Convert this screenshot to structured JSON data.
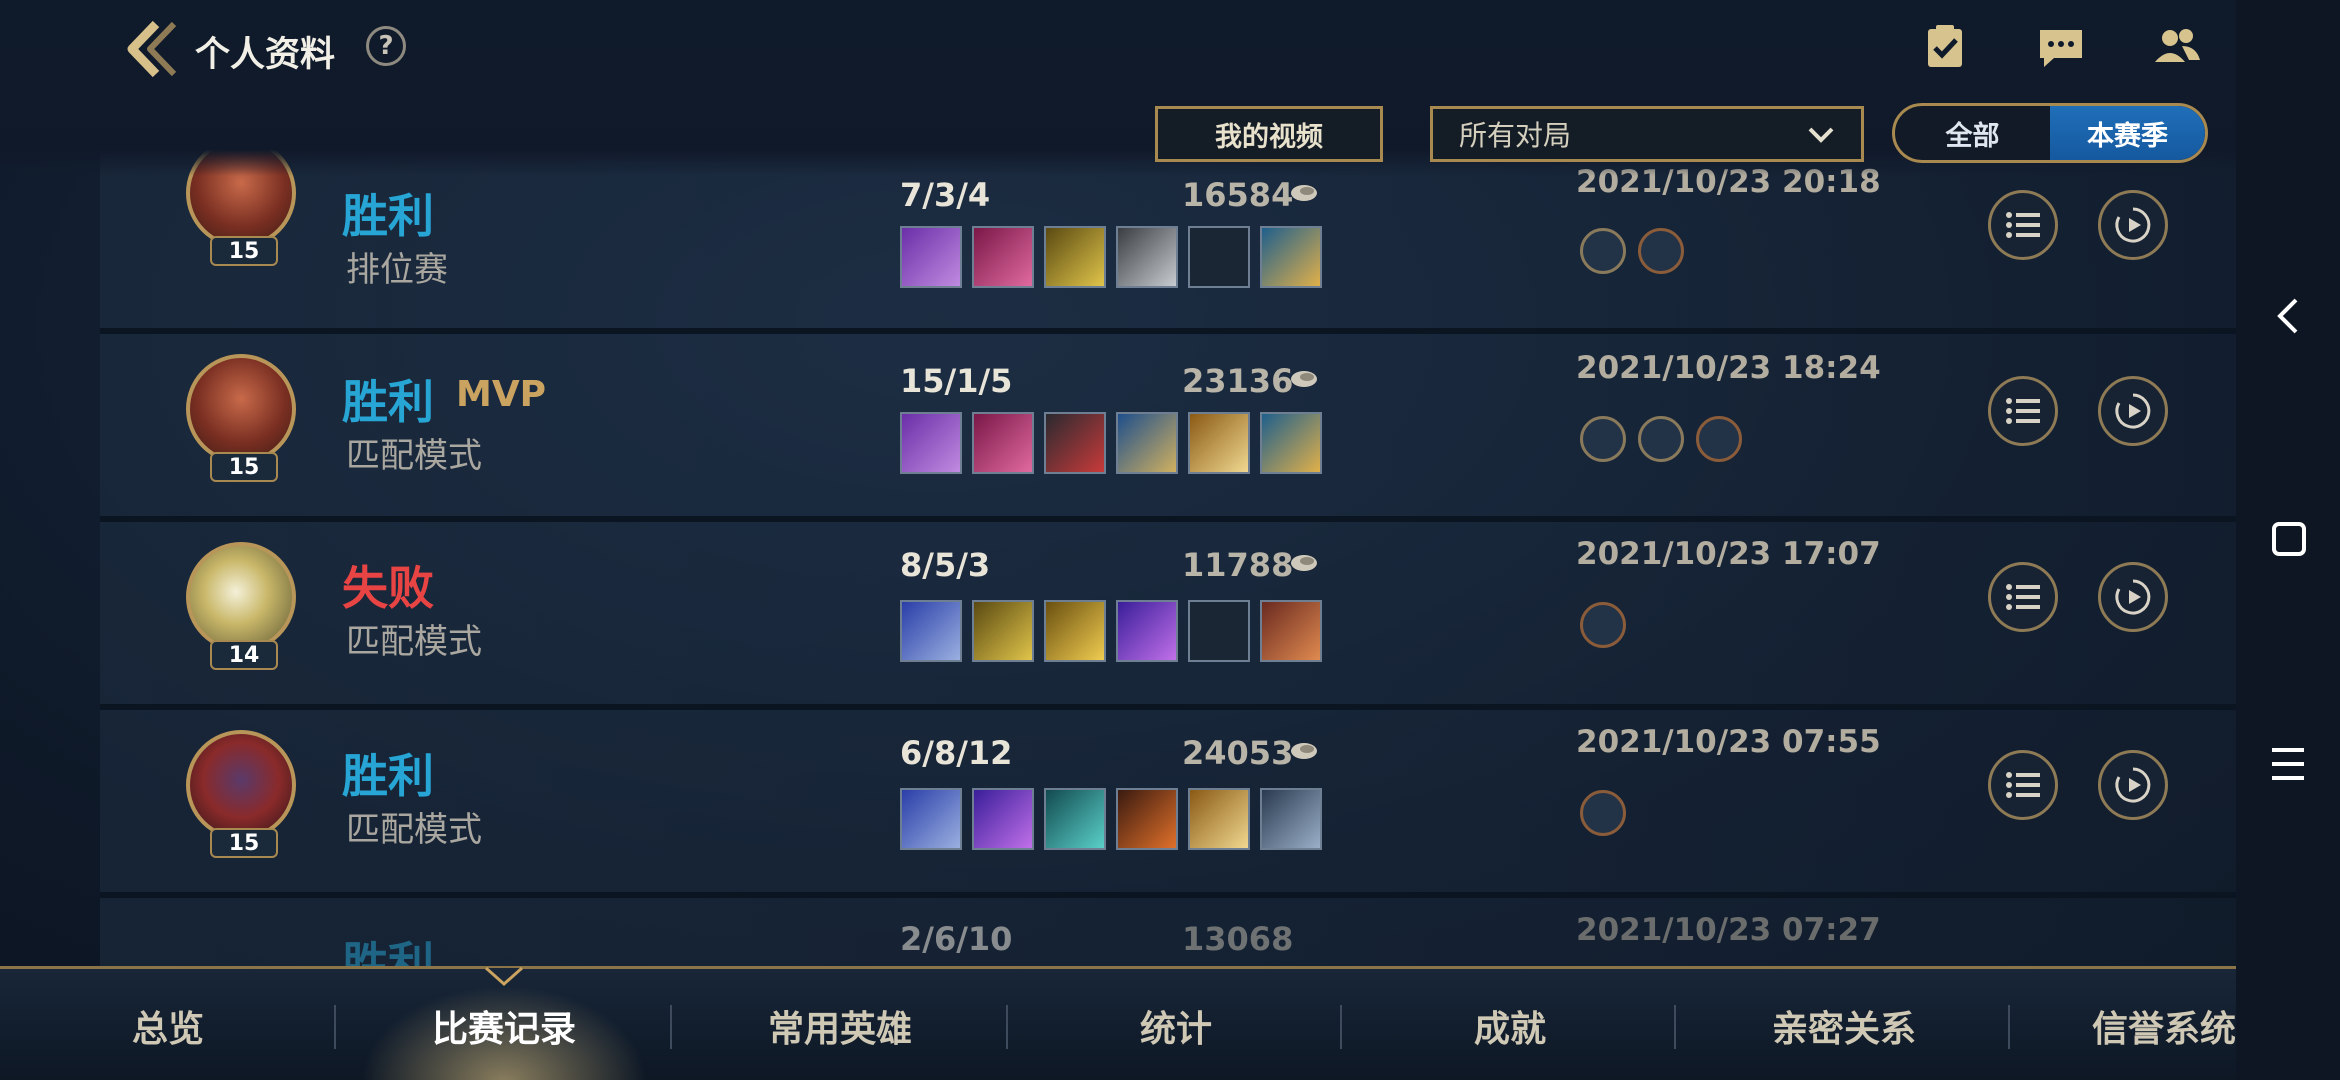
{
  "header": {
    "title": "个人资料",
    "help_label": "?"
  },
  "filters": {
    "my_videos_label": "我的视频",
    "match_filter_value": "所有对局",
    "season_all_label": "全部",
    "season_current_label": "本赛季"
  },
  "matches": [
    {
      "result": "胜利",
      "mvp": "",
      "mode": "排位赛",
      "level": "15",
      "kda": "7/3/4",
      "gold": "16584",
      "datetime": "2021/10/23 20:18"
    },
    {
      "result": "胜利",
      "mvp": "MVP",
      "mode": "匹配模式",
      "level": "15",
      "kda": "15/1/5",
      "gold": "23136",
      "datetime": "2021/10/23 18:24"
    },
    {
      "result": "失败",
      "mvp": "",
      "mode": "匹配模式",
      "level": "14",
      "kda": "8/5/3",
      "gold": "11788",
      "datetime": "2021/10/23 17:07"
    },
    {
      "result": "胜利",
      "mvp": "",
      "mode": "匹配模式",
      "level": "15",
      "kda": "6/8/12",
      "gold": "24053",
      "datetime": "2021/10/23 07:55"
    },
    {
      "result": "胜利",
      "mvp": "",
      "mode": "",
      "level": "",
      "kda": "2/6/10",
      "gold": "13068",
      "datetime": "2021/10/23 07:27"
    }
  ],
  "tabs": [
    "总览",
    "比赛记录",
    "常用英雄",
    "统计",
    "成就",
    "亲密关系",
    "信誉系统"
  ],
  "active_tab": "比赛记录",
  "icons": {
    "back": "chevron-left-icon",
    "tasks": "clipboard-check-icon",
    "chat": "chat-bubble-icon",
    "friends": "friends-icon",
    "detail": "list-icon",
    "replay": "play-icon",
    "gold": "coin-icon"
  },
  "colors": {
    "win": "#27a6d6",
    "loss": "#e84444",
    "mvp": "#c9a35f",
    "accent_gold": "#a8894f",
    "toggle_active": "#1f6fb8"
  }
}
